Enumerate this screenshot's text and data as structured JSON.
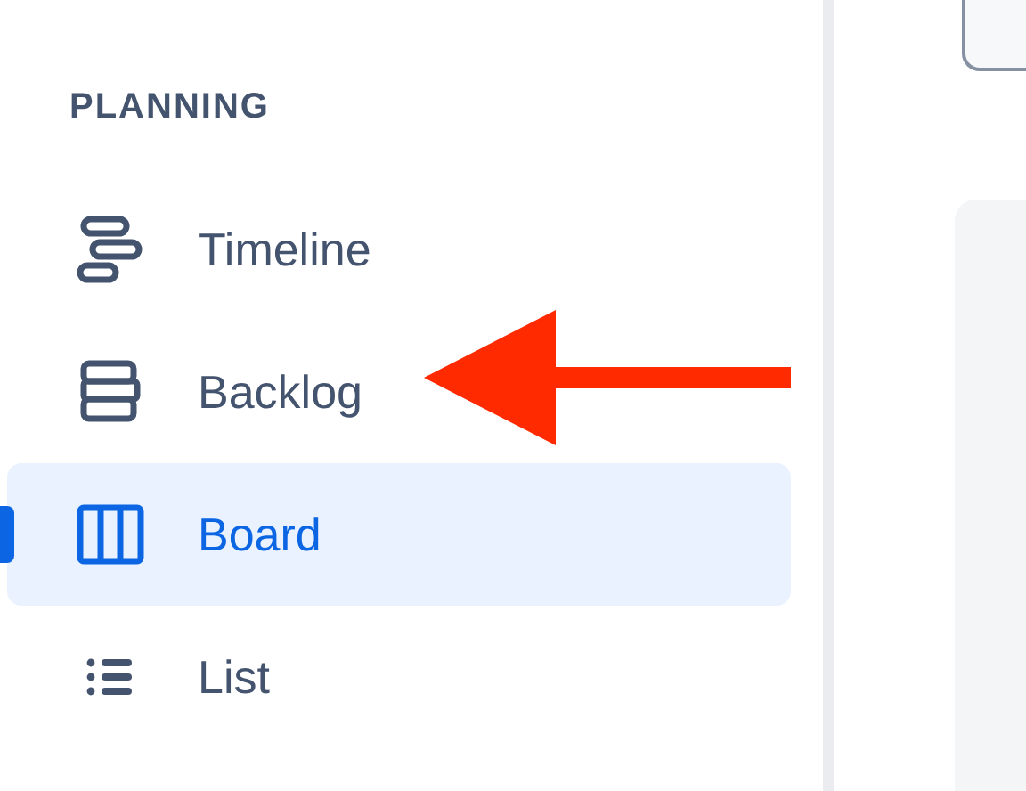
{
  "sidebar": {
    "heading": "PLANNING",
    "items": [
      {
        "kind": "timeline",
        "label": "Timeline",
        "selected": false
      },
      {
        "kind": "backlog",
        "label": "Backlog",
        "selected": false
      },
      {
        "kind": "board",
        "label": "Board",
        "selected": true
      },
      {
        "kind": "list",
        "label": "List",
        "selected": false
      }
    ]
  }
}
